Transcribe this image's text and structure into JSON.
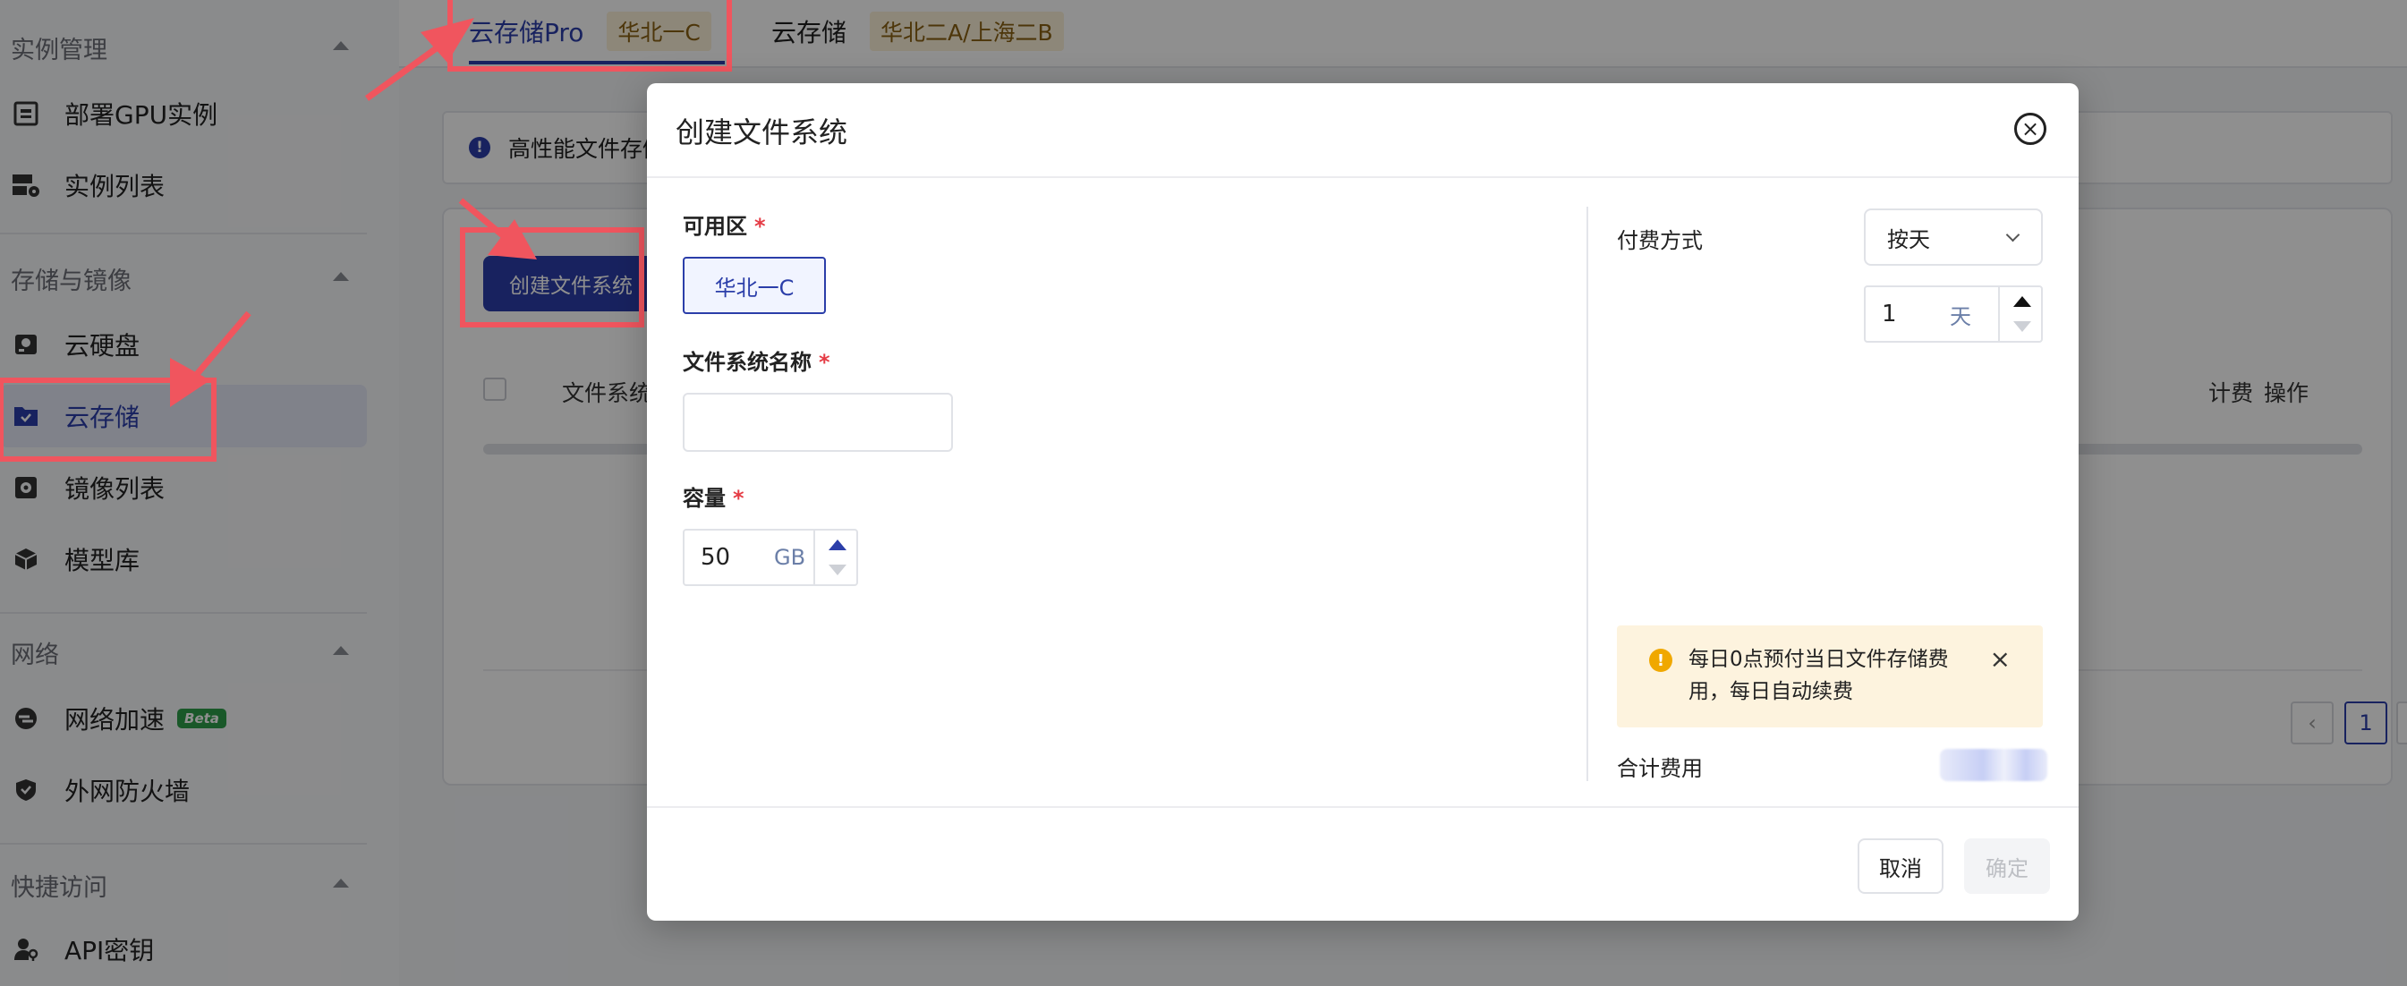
{
  "sidebar": {
    "sections": [
      {
        "title": "实例管理",
        "items": [
          "部署GPU实例",
          "实例列表"
        ]
      },
      {
        "title": "存储与镜像",
        "items": [
          "云硬盘",
          "云存储",
          "镜像列表",
          "模型库"
        ]
      },
      {
        "title": "网络",
        "items": [
          "网络加速",
          "外网防火墙"
        ]
      },
      {
        "title": "快捷访问",
        "items": [
          "API密钥"
        ]
      }
    ],
    "beta_badge": "Beta",
    "active_item": "云存储"
  },
  "tabs": [
    {
      "label": "云存储Pro",
      "tag": "华北一C"
    },
    {
      "label": "云存储",
      "tag": "华北二A/上海二B"
    }
  ],
  "notice": {
    "text": "高性能文件存储"
  },
  "page": {
    "create_button": "创建文件系统",
    "table_headers": [
      "文件系统",
      "计费",
      "操作"
    ],
    "pagination": {
      "current": "1",
      "prev": "‹"
    }
  },
  "modal": {
    "title": "创建文件系统",
    "zone": {
      "label": "可用区",
      "selected": "华北一C"
    },
    "name": {
      "label": "文件系统名称",
      "value": ""
    },
    "capacity": {
      "label": "容量",
      "value": "50",
      "unit": "GB"
    },
    "billing": {
      "label": "付费方式",
      "selected": "按天",
      "duration_value": "1",
      "duration_unit": "天"
    },
    "warning": {
      "text": "每日0点预付当日文件存储费用，每日自动续费"
    },
    "total": {
      "label": "合计费用"
    },
    "cancel_button": "取消",
    "confirm_button": "确定"
  },
  "colors": {
    "accent": "#2b3ea9",
    "annotation": "#f0555e",
    "warning_bg": "#fdf3de",
    "warning_icon": "#f0a800",
    "required": "#e53c45"
  }
}
